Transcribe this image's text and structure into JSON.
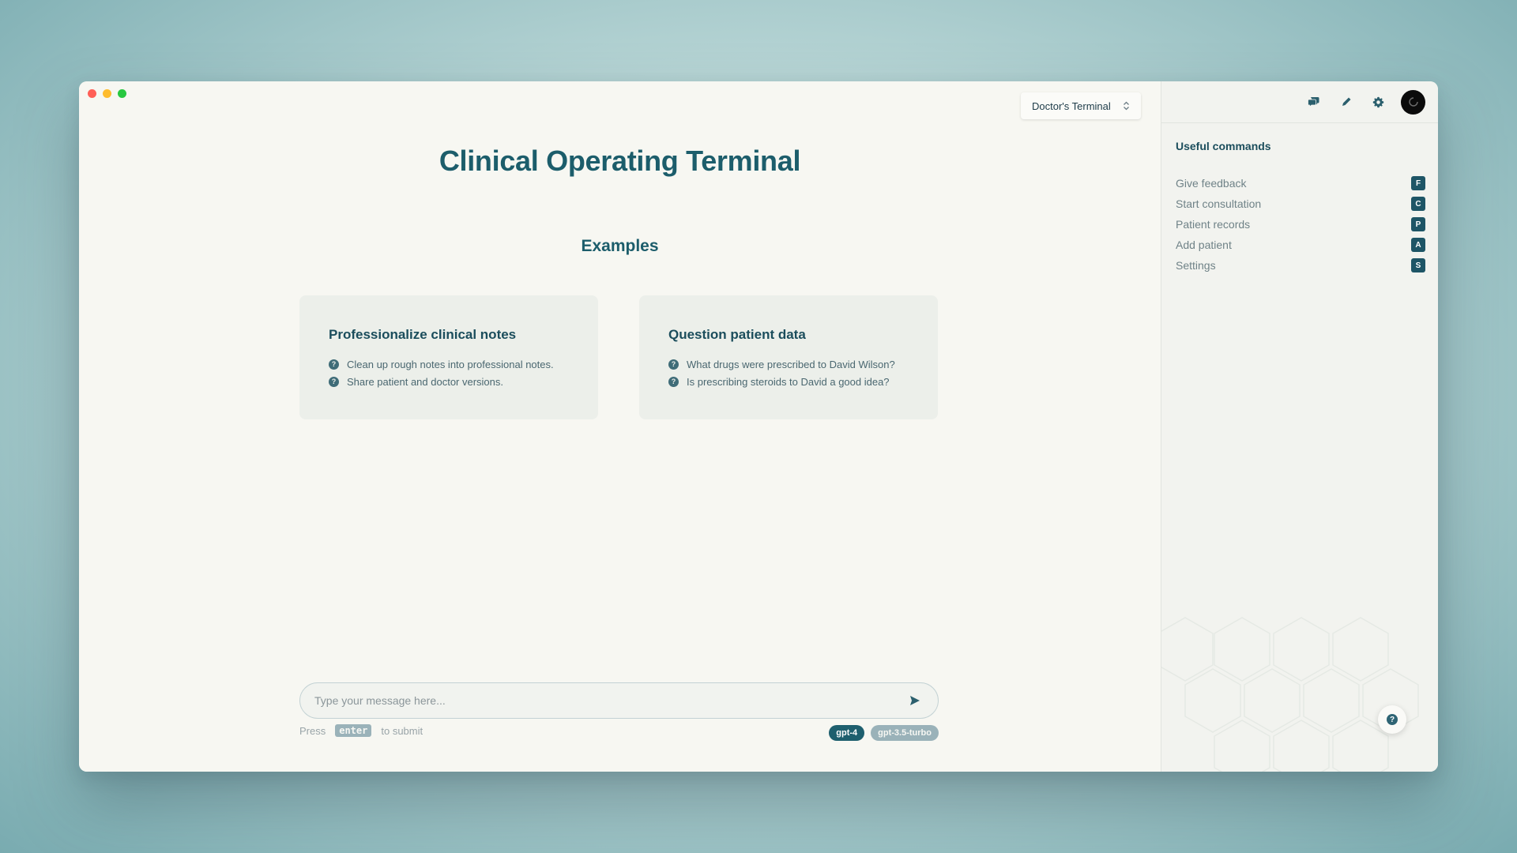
{
  "window": {
    "traffic_lights": [
      "close",
      "minimize",
      "zoom"
    ]
  },
  "header": {
    "terminal_selector": "Doctor's Terminal",
    "title": "Clinical Operating Terminal"
  },
  "examples": {
    "heading": "Examples",
    "cards": [
      {
        "title": "Professionalize clinical notes",
        "items": [
          "Clean up rough notes into professional notes.",
          "Share patient and doctor versions."
        ]
      },
      {
        "title": "Question patient data",
        "items": [
          "What drugs were prescribed to David Wilson?",
          "Is prescribing steroids to David a good idea?"
        ]
      }
    ]
  },
  "composer": {
    "placeholder": "Type your message here...",
    "hint_prefix": "Press",
    "hint_key": "enter",
    "hint_suffix": "to submit",
    "models": [
      {
        "label": "gpt-4",
        "active": true
      },
      {
        "label": "gpt-3.5-turbo",
        "active": false
      }
    ]
  },
  "sidebar": {
    "toolbar_icons": [
      "chat-icon",
      "pencil-icon",
      "gear-icon",
      "avatar"
    ],
    "heading": "Useful commands",
    "commands": [
      {
        "label": "Give feedback",
        "key": "F"
      },
      {
        "label": "Start consultation",
        "key": "C"
      },
      {
        "label": "Patient records",
        "key": "P"
      },
      {
        "label": "Add patient",
        "key": "A"
      },
      {
        "label": "Settings",
        "key": "S"
      }
    ],
    "help_icon": "question-icon"
  },
  "colors": {
    "accent": "#1c5d6b",
    "background": "#f7f7f2",
    "sidebar": "#f2f3ef",
    "card": "#ecefea"
  }
}
